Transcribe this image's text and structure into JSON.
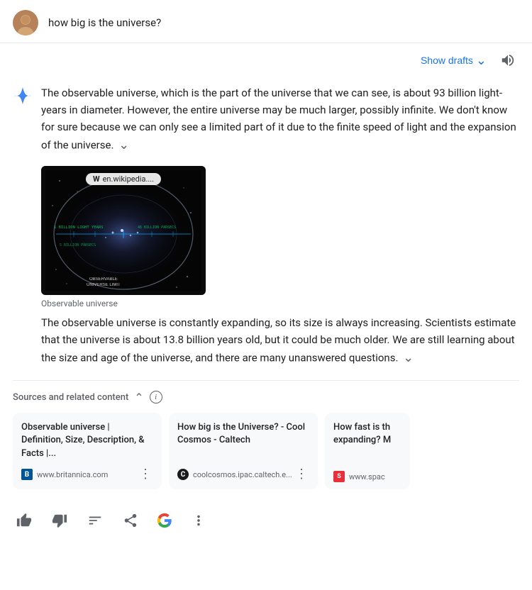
{
  "header": {
    "query": "how big is the universe?"
  },
  "toolbar": {
    "show_drafts_label": "Show drafts"
  },
  "answer": {
    "paragraph1": "The observable universe, which is the part of the universe that we can see, is about 93 billion light-years in diameter. However, the entire universe may be much larger, possibly infinite. We don't know for sure because we can only see a limited part of it due to the finite speed of light and the expansion of the universe.",
    "image_caption": "Observable universe",
    "wiki_badge": "en.wikipedia....",
    "paragraph2": "The observable universe is constantly expanding, so its size is always increasing. Scientists estimate that the universe is about 13.8 billion years old, but it could be much older. We are still learning about the size and age of the universe, and there are many unanswered questions."
  },
  "sources": {
    "label": "Sources and related content",
    "cards": [
      {
        "title": "Observable universe | Definition, Size, Description, & Facts |...",
        "domain": "www.britannica.com",
        "favicon_type": "britannica"
      },
      {
        "title": "How big is the Universe? - Cool Cosmos - Caltech",
        "domain": "coolcosmos.ipac.caltech.e...",
        "favicon_type": "caltech"
      },
      {
        "title": "How fast is th expanding? M",
        "domain": "www.spac",
        "favicon_type": "space"
      }
    ]
  },
  "bottom_icons": {
    "thumbs_up": "👍",
    "thumbs_down": "👎",
    "hashtag": "⊞",
    "share": "↗",
    "google": "G",
    "menu": "⋮"
  }
}
